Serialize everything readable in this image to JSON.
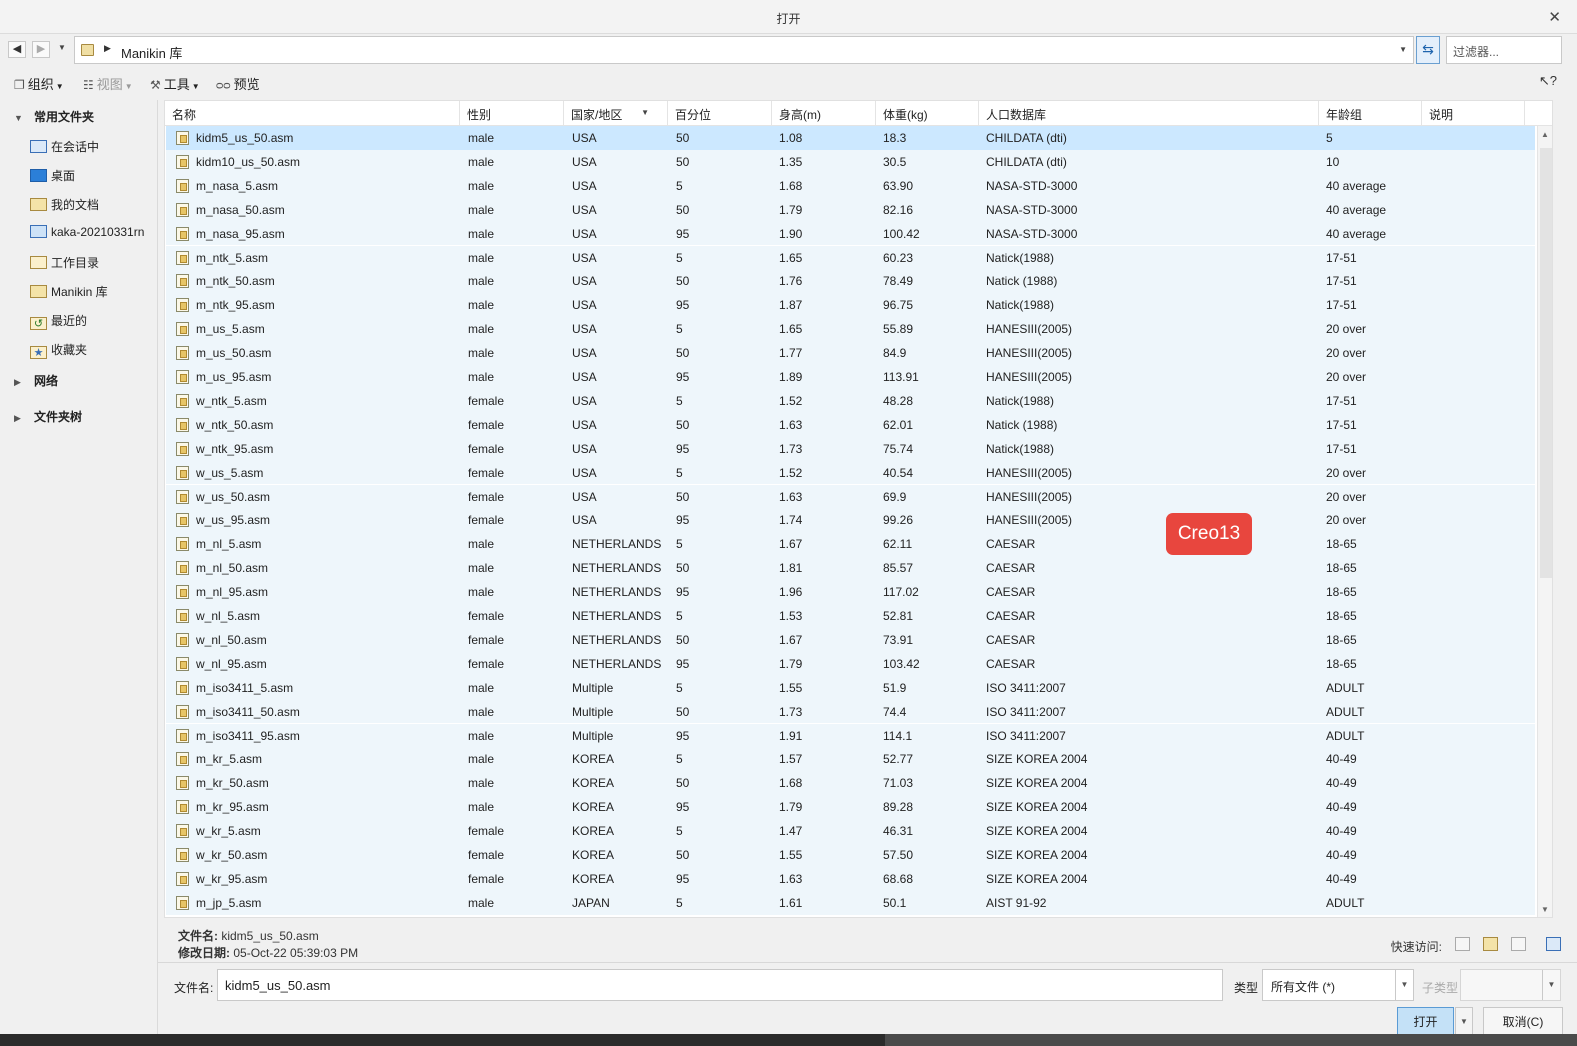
{
  "window": {
    "title": "打开"
  },
  "address": {
    "crumb": "Manikin 库",
    "filter_placeholder": "过滤器..."
  },
  "toolbar": {
    "organize": "组织",
    "view": "视图",
    "tools": "工具",
    "preview": "预览"
  },
  "sidebar": {
    "favorites_header": "常用文件夹",
    "items": [
      {
        "label": "在会话中",
        "icon": "monitor-icon"
      },
      {
        "label": "桌面",
        "icon": "desktop-icon"
      },
      {
        "label": "我的文档",
        "icon": "documents-icon"
      },
      {
        "label": "kaka-20210331rn",
        "icon": "computer-icon"
      },
      {
        "label": "工作目录",
        "icon": "working-dir-icon"
      },
      {
        "label": "Manikin 库",
        "icon": "library-icon"
      },
      {
        "label": "最近的",
        "icon": "recent-icon"
      },
      {
        "label": "收藏夹",
        "icon": "favorites-icon"
      }
    ],
    "network_header": "网络",
    "foldertree_header": "文件夹树"
  },
  "columns": [
    "名称",
    "性别",
    "国家/地区",
    "百分位",
    "身高(m)",
    "体重(kg)",
    "人口数据库",
    "年龄组",
    "说明"
  ],
  "rows": [
    [
      "kidm5_us_50.asm",
      "male",
      "USA",
      "50",
      "1.08",
      "18.3",
      "CHILDATA (dti)",
      "5"
    ],
    [
      "kidm10_us_50.asm",
      "male",
      "USA",
      "50",
      "1.35",
      "30.5",
      "CHILDATA (dti)",
      "10"
    ],
    [
      "m_nasa_5.asm",
      "male",
      "USA",
      "5",
      "1.68",
      "63.90",
      "NASA-STD-3000",
      "40 average"
    ],
    [
      "m_nasa_50.asm",
      "male",
      "USA",
      "50",
      "1.79",
      "82.16",
      "NASA-STD-3000",
      "40 average"
    ],
    [
      "m_nasa_95.asm",
      "male",
      "USA",
      "95",
      "1.90",
      "100.42",
      "NASA-STD-3000",
      "40 average"
    ],
    [
      "m_ntk_5.asm",
      "male",
      "USA",
      "5",
      "1.65",
      "60.23",
      "Natick(1988)",
      "17-51"
    ],
    [
      "m_ntk_50.asm",
      "male",
      "USA",
      "50",
      "1.76",
      "78.49",
      "Natick (1988)",
      "17-51"
    ],
    [
      "m_ntk_95.asm",
      "male",
      "USA",
      "95",
      "1.87",
      "96.75",
      "Natick(1988)",
      "17-51"
    ],
    [
      "m_us_5.asm",
      "male",
      "USA",
      "5",
      "1.65",
      "55.89",
      "HANESIII(2005)",
      "20 over"
    ],
    [
      "m_us_50.asm",
      "male",
      "USA",
      "50",
      "1.77",
      "84.9",
      "HANESIII(2005)",
      "20 over"
    ],
    [
      "m_us_95.asm",
      "male",
      "USA",
      "95",
      "1.89",
      "113.91",
      "HANESIII(2005)",
      "20 over"
    ],
    [
      "w_ntk_5.asm",
      "female",
      "USA",
      "5",
      "1.52",
      "48.28",
      "Natick(1988)",
      "17-51"
    ],
    [
      "w_ntk_50.asm",
      "female",
      "USA",
      "50",
      "1.63",
      "62.01",
      "Natick (1988)",
      "17-51"
    ],
    [
      "w_ntk_95.asm",
      "female",
      "USA",
      "95",
      "1.73",
      "75.74",
      "Natick(1988)",
      "17-51"
    ],
    [
      "w_us_5.asm",
      "female",
      "USA",
      "5",
      "1.52",
      "40.54",
      "HANESIII(2005)",
      "20 over"
    ],
    [
      "w_us_50.asm",
      "female",
      "USA",
      "50",
      "1.63",
      "69.9",
      "HANESIII(2005)",
      "20 over"
    ],
    [
      "w_us_95.asm",
      "female",
      "USA",
      "95",
      "1.74",
      "99.26",
      "HANESIII(2005)",
      "20 over"
    ],
    [
      "m_nl_5.asm",
      "male",
      "NETHERLANDS",
      "5",
      "1.67",
      "62.11",
      "CAESAR",
      "18-65"
    ],
    [
      "m_nl_50.asm",
      "male",
      "NETHERLANDS",
      "50",
      "1.81",
      "85.57",
      "CAESAR",
      "18-65"
    ],
    [
      "m_nl_95.asm",
      "male",
      "NETHERLANDS",
      "95",
      "1.96",
      "117.02",
      "CAESAR",
      "18-65"
    ],
    [
      "w_nl_5.asm",
      "female",
      "NETHERLANDS",
      "5",
      "1.53",
      "52.81",
      "CAESAR",
      "18-65"
    ],
    [
      "w_nl_50.asm",
      "female",
      "NETHERLANDS",
      "50",
      "1.67",
      "73.91",
      "CAESAR",
      "18-65"
    ],
    [
      "w_nl_95.asm",
      "female",
      "NETHERLANDS",
      "95",
      "1.79",
      "103.42",
      "CAESAR",
      "18-65"
    ],
    [
      "m_iso3411_5.asm",
      "male",
      "Multiple",
      "5",
      "1.55",
      "51.9",
      "ISO 3411:2007",
      "ADULT"
    ],
    [
      "m_iso3411_50.asm",
      "male",
      "Multiple",
      "50",
      "1.73",
      "74.4",
      "ISO 3411:2007",
      "ADULT"
    ],
    [
      "m_iso3411_95.asm",
      "male",
      "Multiple",
      "95",
      "1.91",
      "114.1",
      "ISO 3411:2007",
      "ADULT"
    ],
    [
      "m_kr_5.asm",
      "male",
      "KOREA",
      "5",
      "1.57",
      "52.77",
      "SIZE KOREA 2004",
      "40-49"
    ],
    [
      "m_kr_50.asm",
      "male",
      "KOREA",
      "50",
      "1.68",
      "71.03",
      "SIZE KOREA 2004",
      "40-49"
    ],
    [
      "m_kr_95.asm",
      "male",
      "KOREA",
      "95",
      "1.79",
      "89.28",
      "SIZE KOREA 2004",
      "40-49"
    ],
    [
      "w_kr_5.asm",
      "female",
      "KOREA",
      "5",
      "1.47",
      "46.31",
      "SIZE KOREA 2004",
      "40-49"
    ],
    [
      "w_kr_50.asm",
      "female",
      "KOREA",
      "50",
      "1.55",
      "57.50",
      "SIZE KOREA 2004",
      "40-49"
    ],
    [
      "w_kr_95.asm",
      "female",
      "KOREA",
      "95",
      "1.63",
      "68.68",
      "SIZE KOREA 2004",
      "40-49"
    ],
    [
      "m_jp_5.asm",
      "male",
      "JAPAN",
      "5",
      "1.61",
      "50.1",
      "AIST 91-92",
      "ADULT"
    ]
  ],
  "selected_row": 0,
  "watermark": "Creo13",
  "info": {
    "filename_label": "文件名:",
    "filename_value": "kidm5_us_50.asm",
    "modified_label": "修改日期:",
    "modified_value": "05-Oct-22 05:39:03 PM",
    "quick_access": "快速访问:"
  },
  "footer": {
    "filename_label": "文件名:",
    "filename_value": "kidm5_us_50.asm",
    "type_label": "类型",
    "type_value": "所有文件 (*)",
    "subtype_label": "子类型",
    "open": "打开",
    "cancel": "取消(C)"
  },
  "colors": {
    "selection": "#cce8ff",
    "accent": "#5a9bd5",
    "watermark_bg": "#e8463e"
  }
}
